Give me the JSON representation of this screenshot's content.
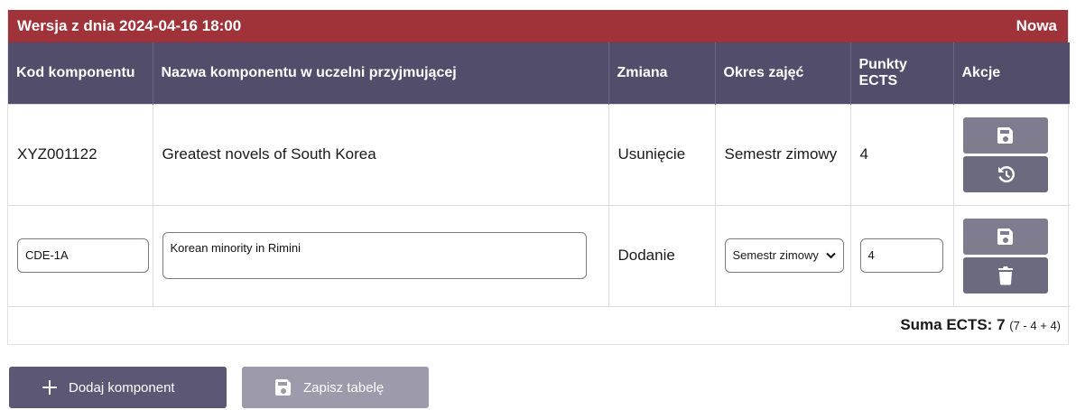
{
  "version": {
    "title": "Wersja z dnia 2024-04-16 18:00",
    "status": "Nowa"
  },
  "table": {
    "headers": {
      "code": "Kod komponentu",
      "name": "Nazwa komponentu w uczelni przyjmującej",
      "change": "Zmiana",
      "period": "Okres zajęć",
      "ects": "Punkty ECTS",
      "actions": "Akcje"
    },
    "rows": [
      {
        "code": "XYZ001122",
        "name": "Greatest novels of South Korea",
        "change": "Usunięcie",
        "period": "Semestr zimowy",
        "ects": "4"
      },
      {
        "code": "CDE-1A",
        "name": "Korean minority in Rimini",
        "change": "Dodanie",
        "period": "Semestr zimowy",
        "ects": "4"
      }
    ],
    "sum": {
      "label": "Suma ECTS:",
      "value": "7",
      "formula": "(7 - 4 + 4)"
    }
  },
  "buttons": {
    "add": "Dodaj komponent",
    "save_table": "Zapisz tabelę"
  },
  "icons": {
    "save": "floppy-disk-icon",
    "restore": "history-icon",
    "delete": "trash-icon",
    "add": "plus-icon"
  }
}
